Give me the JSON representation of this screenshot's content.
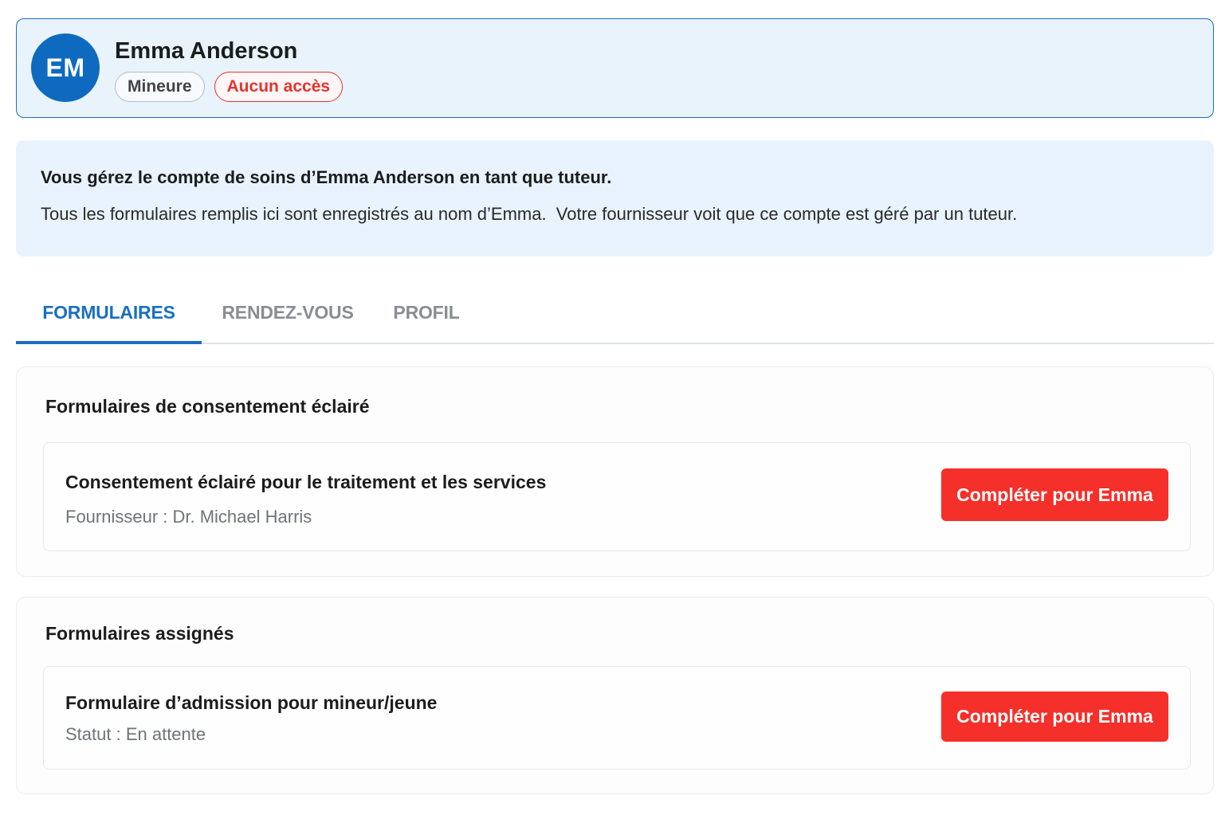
{
  "patient": {
    "initials": "EM",
    "name": "Emma Anderson",
    "badges": {
      "minor": "Mineure",
      "access": "Aucun accès"
    }
  },
  "notice": {
    "title": "Vous gérez le compte de soins d’Emma Anderson en tant que tuteur.",
    "body": "Tous les formulaires remplis ici sont enregistrés au nom d’Emma.  Votre fournisseur voit que ce compte est géré par un tuteur."
  },
  "tabs": [
    {
      "label": "FORMULAIRES",
      "active": true
    },
    {
      "label": "RENDEZ-VOUS",
      "active": false
    },
    {
      "label": "PROFIL",
      "active": false
    }
  ],
  "sections": {
    "consent": {
      "title": "Formulaires de consentement éclairé",
      "items": [
        {
          "title": "Consentement éclairé pour le traitement et les services",
          "subtitle": "Fournisseur : Dr. Michael Harris",
          "action": "Compléter pour Emma"
        }
      ]
    },
    "assigned": {
      "title": "Formulaires assignés",
      "items": [
        {
          "title": "Formulaire d’admission pour mineur/jeune",
          "subtitle": "Statut : En attente",
          "action": "Compléter pour Emma"
        }
      ]
    }
  },
  "colors": {
    "primary": "#1a6fc0",
    "avatar": "#0d6abf",
    "danger": "#f52f29",
    "panel": "#e8f3fc"
  }
}
